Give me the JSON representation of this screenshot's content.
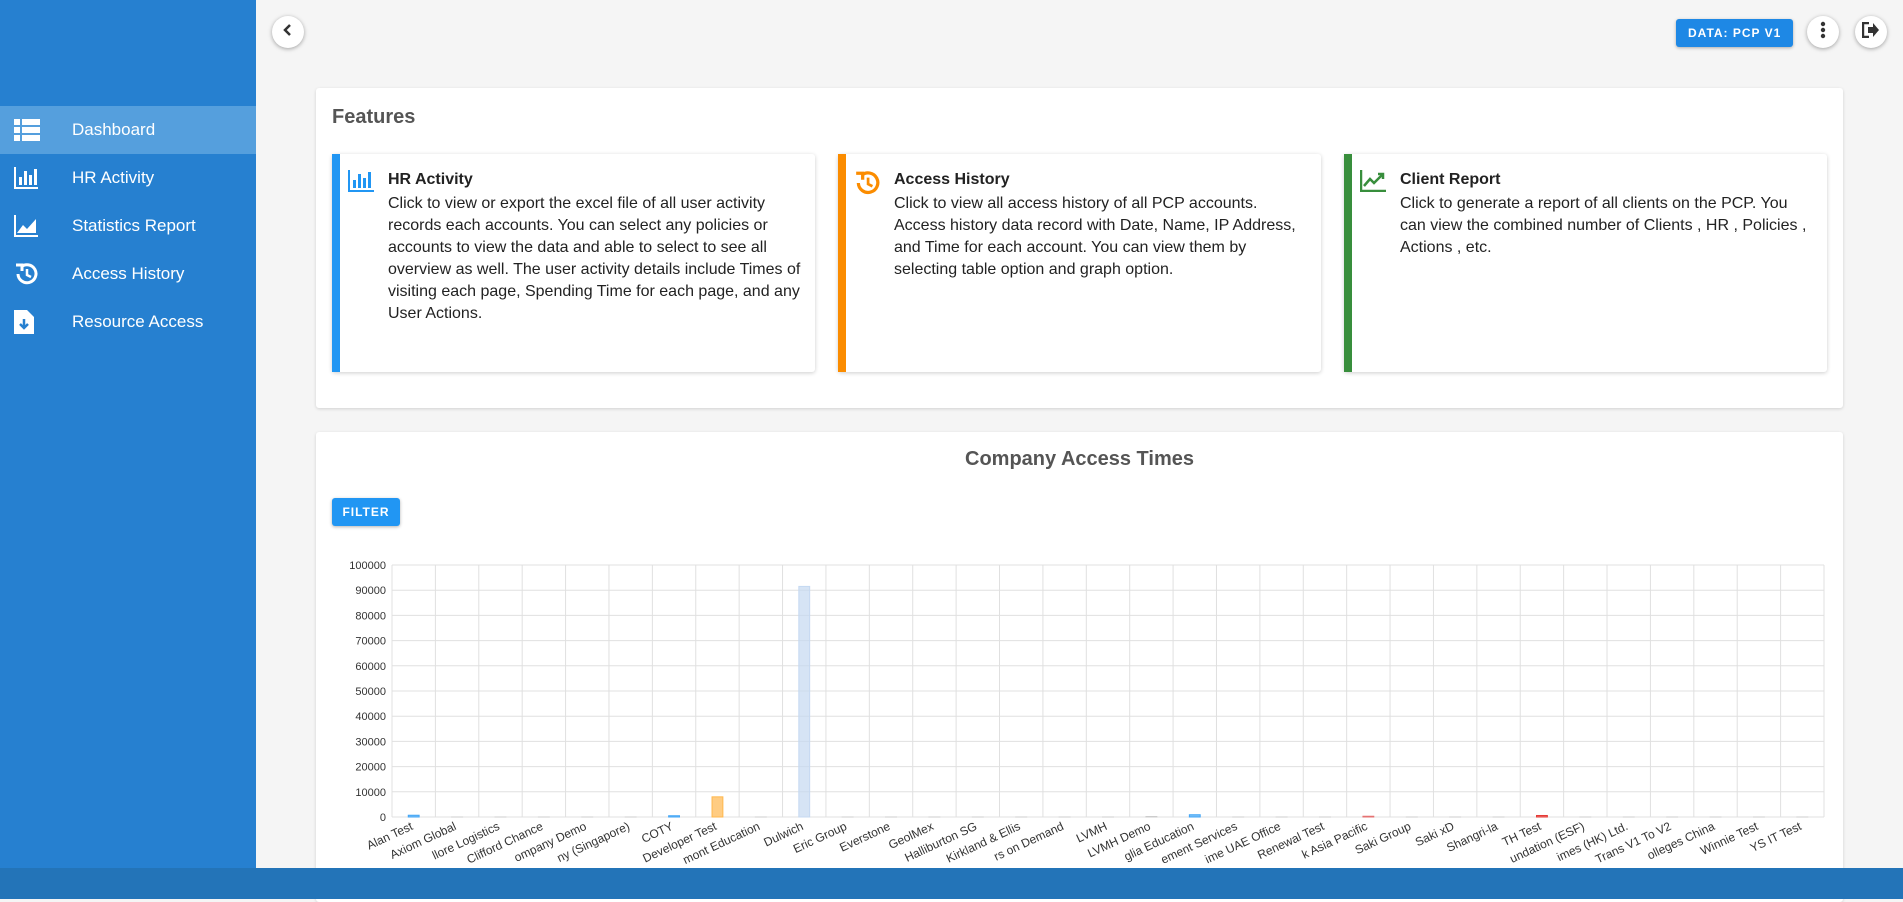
{
  "nav": {
    "items": [
      {
        "label": "Dashboard",
        "icon": "list-icon",
        "active": true
      },
      {
        "label": "HR Activity",
        "icon": "bar-chart-icon"
      },
      {
        "label": "Statistics Report",
        "icon": "area-chart-icon"
      },
      {
        "label": "Access History",
        "icon": "history-icon"
      },
      {
        "label": "Resource Access",
        "icon": "download-file-icon"
      }
    ]
  },
  "topbar": {
    "data_label": "DATA: PCP V1"
  },
  "features": {
    "title": "Features",
    "cards": [
      {
        "title": "HR Activity",
        "color": "#2196f3",
        "icon": "bar-chart-icon",
        "text": "Click to view or export the excel file of all user activity records each accounts. You can select any policies or accounts to view the data and able to select to see all overview as well. The user activity details include Times of visiting each page, Spending Time for each page, and any User Actions."
      },
      {
        "title": "Access History",
        "color": "#fb8c00",
        "icon": "history-icon",
        "text": "Click to view all access history of all PCP accounts. Access history data record with Date, Name, IP Address, and Time for each account. You can view them by selecting table option and graph option."
      },
      {
        "title": "Client Report",
        "color": "#388e3c",
        "icon": "trend-icon",
        "text": "Click to generate a report of all clients on the PCP. You can view the combined number of Clients , HR , Policies , Actions , etc."
      }
    ]
  },
  "chart": {
    "title": "Company Access Times",
    "filter_label": "FILTER"
  },
  "chart_data": {
    "type": "bar",
    "title": "Company Access Times",
    "categories": [
      "Alan Test",
      "Axiom Global",
      "Bollore Logistics",
      "Clifford Chance",
      "Company Demo",
      "Company (Singapore)",
      "COTY",
      "Developer Test",
      "Dragon Mont Education",
      "Dulwich",
      "Eric Group",
      "Everstone",
      "GeolMex",
      "Halliburton SG",
      "Kirkland & Ellis",
      "Kitchens on Demand",
      "LVMH",
      "LVMH Demo",
      "Nord Anglia Education",
      "Professional Retirement Services",
      "Regime UAE Office",
      "Renewal Test",
      "Sandvik Asia Pacific",
      "Saki Group",
      "Saki xD",
      "Shangri-la",
      "TH Test",
      "The English Schools Foundation (ESF)",
      "Times (HK) Ltd.",
      "Trans V1 To V2",
      "United World Colleges China",
      "Winnie Test",
      "YS IT Test"
    ],
    "values": [
      700,
      0,
      0,
      0,
      0,
      0,
      500,
      8000,
      0,
      91500,
      0,
      0,
      0,
      0,
      0,
      0,
      0,
      200,
      900,
      0,
      0,
      0,
      300,
      0,
      0,
      0,
      600,
      0,
      0,
      0,
      0,
      0,
      0
    ],
    "colors": [
      "#42a5f5",
      "#ccc",
      "#ccc",
      "#ccc",
      "#ccc",
      "#ccc",
      "#42a5f5",
      "#ffb74d",
      "#ccc",
      "#c5d9f1",
      "#ccc",
      "#ccc",
      "#ccc",
      "#ccc",
      "#ccc",
      "#ccc",
      "#ccc",
      "#ccc",
      "#42a5f5",
      "#ccc",
      "#ccc",
      "#ccc",
      "#e57373",
      "#ccc",
      "#ccc",
      "#ccc",
      "#e53935",
      "#ccc",
      "#ccc",
      "#ccc",
      "#ccc",
      "#ccc",
      "#ccc"
    ],
    "ylim": [
      0,
      100000
    ],
    "yticks": [
      "100000",
      "90000",
      "80000",
      "70000",
      "60000",
      "50000",
      "40000",
      "30000",
      "20000",
      "10000",
      "0"
    ],
    "x_tick_labels": [
      "Alan Test",
      "Axiom Global",
      "llore Logistics",
      "Clifford Chance",
      "ompany Demo",
      "ny (Singapore)",
      "COTY",
      "Developer Test",
      "mont Education",
      "Dulwich",
      "Eric Group",
      "Everstone",
      "GeolMex",
      "Halliburton SG",
      "Kirkland & Ellis",
      "rs on Demand",
      "LVMH",
      "LVMH Demo",
      "glia Education",
      "ement Services",
      "ime UAE Office",
      "Renewal Test",
      "k Asia Pacific",
      "Saki Group",
      "Saki xD",
      "Shangri-la",
      "TH Test",
      "undation (ESF)",
      "imes (HK) Ltd.",
      "Trans V1 To V2",
      "olleges China",
      "Winnie Test",
      "YS IT Test"
    ],
    "grid": true,
    "legend": "none"
  }
}
